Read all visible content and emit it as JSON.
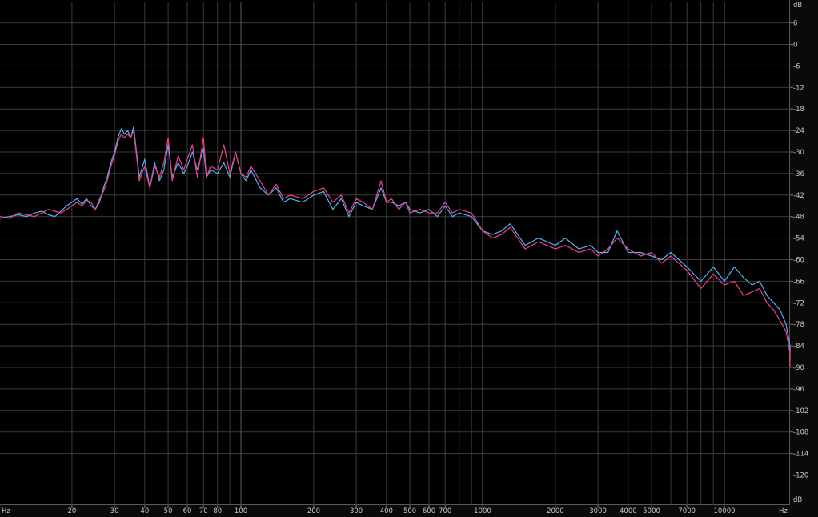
{
  "colors": {
    "background": "#000000",
    "grid": "#3c3c3c",
    "grid_major": "#5c5c5c",
    "channel_left": "#4fb4f0",
    "channel_right": "#f0408c",
    "text": "#c8c8c8"
  },
  "chart_data": {
    "type": "line",
    "title": "",
    "xlabel": "Hz",
    "ylabel": "dB",
    "x_scale": "log",
    "xlim": [
      10,
      20000
    ],
    "ylim": [
      -126,
      6
    ],
    "grid": true,
    "y_ticks": [
      "6",
      "0",
      "-6",
      "-12",
      "-18",
      "-24",
      "-30",
      "-36",
      "-42",
      "-48",
      "-54",
      "-60",
      "-66",
      "-72",
      "-78",
      "-84",
      "-90",
      "-96",
      "-102",
      "-108",
      "-114",
      "-120"
    ],
    "y_unit_top": "dB",
    "y_unit_bottom": "dB",
    "x_unit_left": "Hz",
    "x_unit_right": "Hz",
    "x_ticks": [
      {
        "value": 20,
        "label": "20"
      },
      {
        "value": 30,
        "label": "30"
      },
      {
        "value": 40,
        "label": "40"
      },
      {
        "value": 50,
        "label": "50"
      },
      {
        "value": 60,
        "label": "60"
      },
      {
        "value": 70,
        "label": "70"
      },
      {
        "value": 80,
        "label": "80"
      },
      {
        "value": 100,
        "label": "100"
      },
      {
        "value": 200,
        "label": "200"
      },
      {
        "value": 300,
        "label": "300"
      },
      {
        "value": 400,
        "label": "400"
      },
      {
        "value": 500,
        "label": "500"
      },
      {
        "value": 600,
        "label": "600"
      },
      {
        "value": 700,
        "label": "700"
      },
      {
        "value": 1000,
        "label": "1000"
      },
      {
        "value": 2000,
        "label": "2000"
      },
      {
        "value": 3000,
        "label": "3000"
      },
      {
        "value": 4000,
        "label": "4000"
      },
      {
        "value": 5000,
        "label": "5000"
      },
      {
        "value": 7000,
        "label": "7000"
      },
      {
        "value": 10000,
        "label": "10000"
      }
    ],
    "series": [
      {
        "channel": "left",
        "x": [
          10,
          11,
          12,
          13,
          14,
          15,
          16,
          17,
          18,
          19,
          20,
          21,
          22,
          23,
          24,
          25,
          26,
          27,
          28,
          29,
          30,
          31,
          32,
          33,
          34,
          35,
          36,
          38,
          40,
          42,
          44,
          46,
          48,
          50,
          52,
          55,
          58,
          60,
          63,
          66,
          70,
          72,
          75,
          80,
          85,
          90,
          95,
          100,
          105,
          110,
          120,
          130,
          140,
          150,
          160,
          180,
          200,
          220,
          240,
          260,
          280,
          300,
          320,
          350,
          380,
          400,
          420,
          450,
          480,
          500,
          550,
          600,
          650,
          700,
          750,
          800,
          900,
          1000,
          1100,
          1200,
          1300,
          1500,
          1700,
          2000,
          2200,
          2500,
          2800,
          3000,
          3300,
          3600,
          4000,
          4500,
          5000,
          5500,
          6000,
          7000,
          8000,
          9000,
          10000,
          11000,
          12000,
          13000,
          14000,
          15000,
          16000,
          17000,
          18000,
          19000,
          20000
        ],
        "y": [
          -48.5,
          -48,
          -47.5,
          -48,
          -47,
          -46.5,
          -47.5,
          -48,
          -46.5,
          -45,
          -44,
          -43,
          -44.5,
          -43,
          -45,
          -46,
          -44,
          -40,
          -37,
          -33,
          -30,
          -26,
          -23.5,
          -25,
          -24,
          -26,
          -23,
          -37,
          -32,
          -40,
          -33,
          -38,
          -35,
          -28,
          -37,
          -33,
          -36,
          -34,
          -30,
          -35,
          -29,
          -37,
          -35,
          -36,
          -33,
          -37,
          -30,
          -36,
          -38,
          -35,
          -40,
          -42,
          -40,
          -44,
          -43,
          -44,
          -42,
          -41,
          -46,
          -43,
          -48,
          -44,
          -45,
          -46,
          -40,
          -44,
          -44,
          -45,
          -44,
          -46,
          -47,
          -46,
          -48,
          -45,
          -48,
          -47,
          -48,
          -52,
          -53,
          -52,
          -50,
          -56,
          -54,
          -56,
          -54,
          -57,
          -56,
          -58,
          -58,
          -52,
          -58,
          -58,
          -59,
          -60,
          -58,
          -62,
          -66,
          -62,
          -66,
          -62,
          -65,
          -67,
          -66,
          -70,
          -72,
          -74,
          -78,
          -84,
          -88
        ]
      },
      {
        "channel": "right",
        "x": [
          10,
          11,
          12,
          13,
          14,
          15,
          16,
          17,
          18,
          19,
          20,
          21,
          22,
          23,
          24,
          25,
          26,
          27,
          28,
          29,
          30,
          31,
          32,
          33,
          34,
          35,
          36,
          38,
          40,
          42,
          44,
          46,
          48,
          50,
          52,
          55,
          58,
          60,
          63,
          66,
          70,
          72,
          75,
          80,
          85,
          90,
          95,
          100,
          105,
          110,
          120,
          130,
          140,
          150,
          160,
          180,
          200,
          220,
          240,
          260,
          280,
          300,
          320,
          350,
          380,
          400,
          420,
          450,
          480,
          500,
          550,
          600,
          650,
          700,
          750,
          800,
          900,
          1000,
          1100,
          1200,
          1300,
          1500,
          1700,
          2000,
          2200,
          2500,
          2800,
          3000,
          3300,
          3600,
          4000,
          4500,
          5000,
          5500,
          6000,
          7000,
          8000,
          9000,
          10000,
          11000,
          12000,
          13000,
          14000,
          15000,
          16000,
          17000,
          18000,
          19000,
          20000
        ],
        "y": [
          -48,
          -48.5,
          -47,
          -47.5,
          -48,
          -47,
          -46,
          -46.5,
          -47,
          -46,
          -45,
          -44,
          -45,
          -43.5,
          -44,
          -46,
          -43,
          -41,
          -38,
          -34,
          -31,
          -27,
          -25,
          -26,
          -25,
          -26,
          -24,
          -38,
          -34,
          -40,
          -34,
          -37,
          -33,
          -26,
          -38,
          -31,
          -35,
          -32,
          -28,
          -37,
          -26,
          -37,
          -34,
          -35,
          -28,
          -36,
          -30,
          -36,
          -37,
          -34,
          -38,
          -42,
          -39,
          -43,
          -42,
          -43,
          -41,
          -40,
          -44,
          -42,
          -47,
          -43,
          -44,
          -46,
          -38,
          -44,
          -43,
          -46,
          -44,
          -47,
          -46,
          -47,
          -47,
          -44,
          -47,
          -46,
          -47,
          -52,
          -54,
          -53,
          -51,
          -57,
          -55,
          -57,
          -56,
          -58,
          -57,
          -59,
          -57,
          -54,
          -57,
          -59,
          -58,
          -61,
          -59,
          -63,
          -68,
          -64,
          -67,
          -66,
          -70,
          -69,
          -68,
          -72,
          -74,
          -77,
          -80,
          -86,
          -90
        ]
      }
    ]
  }
}
